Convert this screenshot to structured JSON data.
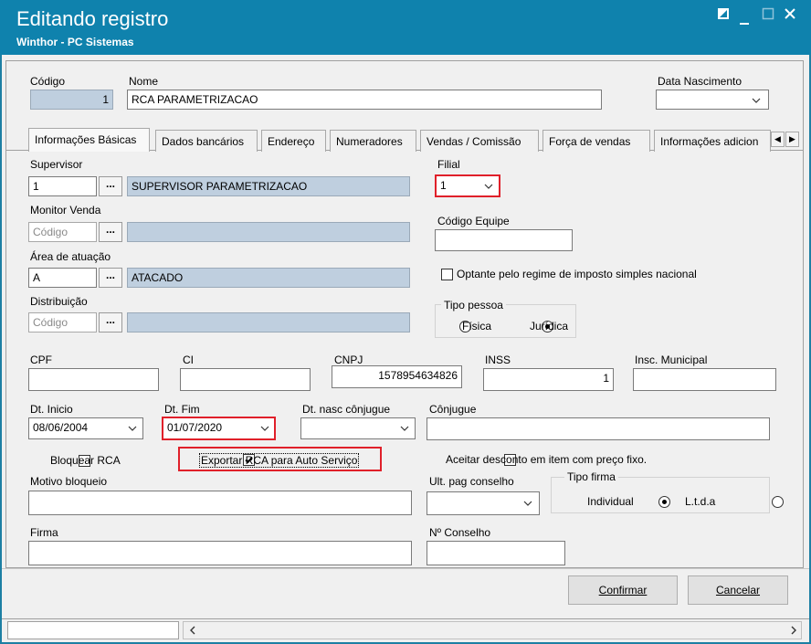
{
  "window": {
    "title": "Editando registro",
    "subtitle": "Winthor - PC Sistemas"
  },
  "header": {
    "codigo_label": "Código",
    "codigo_value": "1",
    "nome_label": "Nome",
    "nome_value": "RCA PARAMETRIZACAO",
    "data_nasc_label": "Data Nascimento",
    "data_nasc_value": ""
  },
  "tabs": [
    {
      "label": "Informações Básicas"
    },
    {
      "label": "Dados bancários"
    },
    {
      "label": "Endereço"
    },
    {
      "label": "Numeradores"
    },
    {
      "label": "Vendas  / Comissão"
    },
    {
      "label": "Força de vendas"
    },
    {
      "label": "Informações adicion"
    }
  ],
  "form": {
    "supervisor_label": "Supervisor",
    "supervisor_code": "1",
    "supervisor_name": "SUPERVISOR PARAMETRIZACAO",
    "monitor_label": "Monitor Venda",
    "monitor_placeholder": "Código",
    "area_label": "Área de atuação",
    "area_code": "A",
    "area_name": "ATACADO",
    "distribuicao_label": "Distribuição",
    "distribuicao_placeholder": "Código",
    "lookup_button": "...",
    "filial_label": "Filial",
    "filial_value": "1",
    "codigo_equipe_label": "Código Equipe",
    "codigo_equipe_value": "",
    "optante_label": "Optante pelo regime de imposto simples nacional",
    "tipo_pessoa_label": "Tipo pessoa",
    "tipo_pessoa_options": [
      "Física",
      "Jurídica"
    ],
    "tipo_pessoa_selected": "Jurídica",
    "cpf_label": "CPF",
    "cpf_value": "",
    "ci_label": "CI",
    "ci_value": "",
    "cnpj_label": "CNPJ",
    "cnpj_value": "1578954634826",
    "inss_label": "INSS",
    "inss_value": "1",
    "insc_municipal_label": "Insc. Municipal",
    "insc_municipal_value": "",
    "dt_inicio_label": "Dt. Inicio",
    "dt_inicio_value": "08/06/2004",
    "dt_fim_label": "Dt. Fim",
    "dt_fim_value": "01/07/2020",
    "dt_nasc_conjuge_label": "Dt. nasc cônjugue",
    "dt_nasc_conjuge_value": "",
    "conjuge_label": "Cônjugue",
    "conjuge_value": "",
    "bloquear_label": "Bloquear RCA",
    "bloquear_checked": false,
    "exportar_label": "Exportar RCA para Auto Serviço",
    "exportar_checked": true,
    "aceitar_label": "Aceitar desconto em item com preço fixo.",
    "aceitar_checked": false,
    "motivo_label": "Motivo bloqueio",
    "motivo_value": "",
    "ult_pag_label": "Ult. pag conselho",
    "ult_pag_value": "",
    "tipo_firma_label": "Tipo firma",
    "tipo_firma_options": [
      "Individual",
      "L.t.d.a"
    ],
    "tipo_firma_selected": "Individual",
    "firma_label": "Firma",
    "firma_value": "",
    "conselho_label": "Nº Conselho",
    "conselho_value": ""
  },
  "buttons": {
    "confirmar": "Confirmar",
    "cancelar": "Cancelar"
  },
  "colors": {
    "titlebar": "#0f82ad",
    "highlight": "#e0202a",
    "readonly": "#bfcfdf"
  }
}
